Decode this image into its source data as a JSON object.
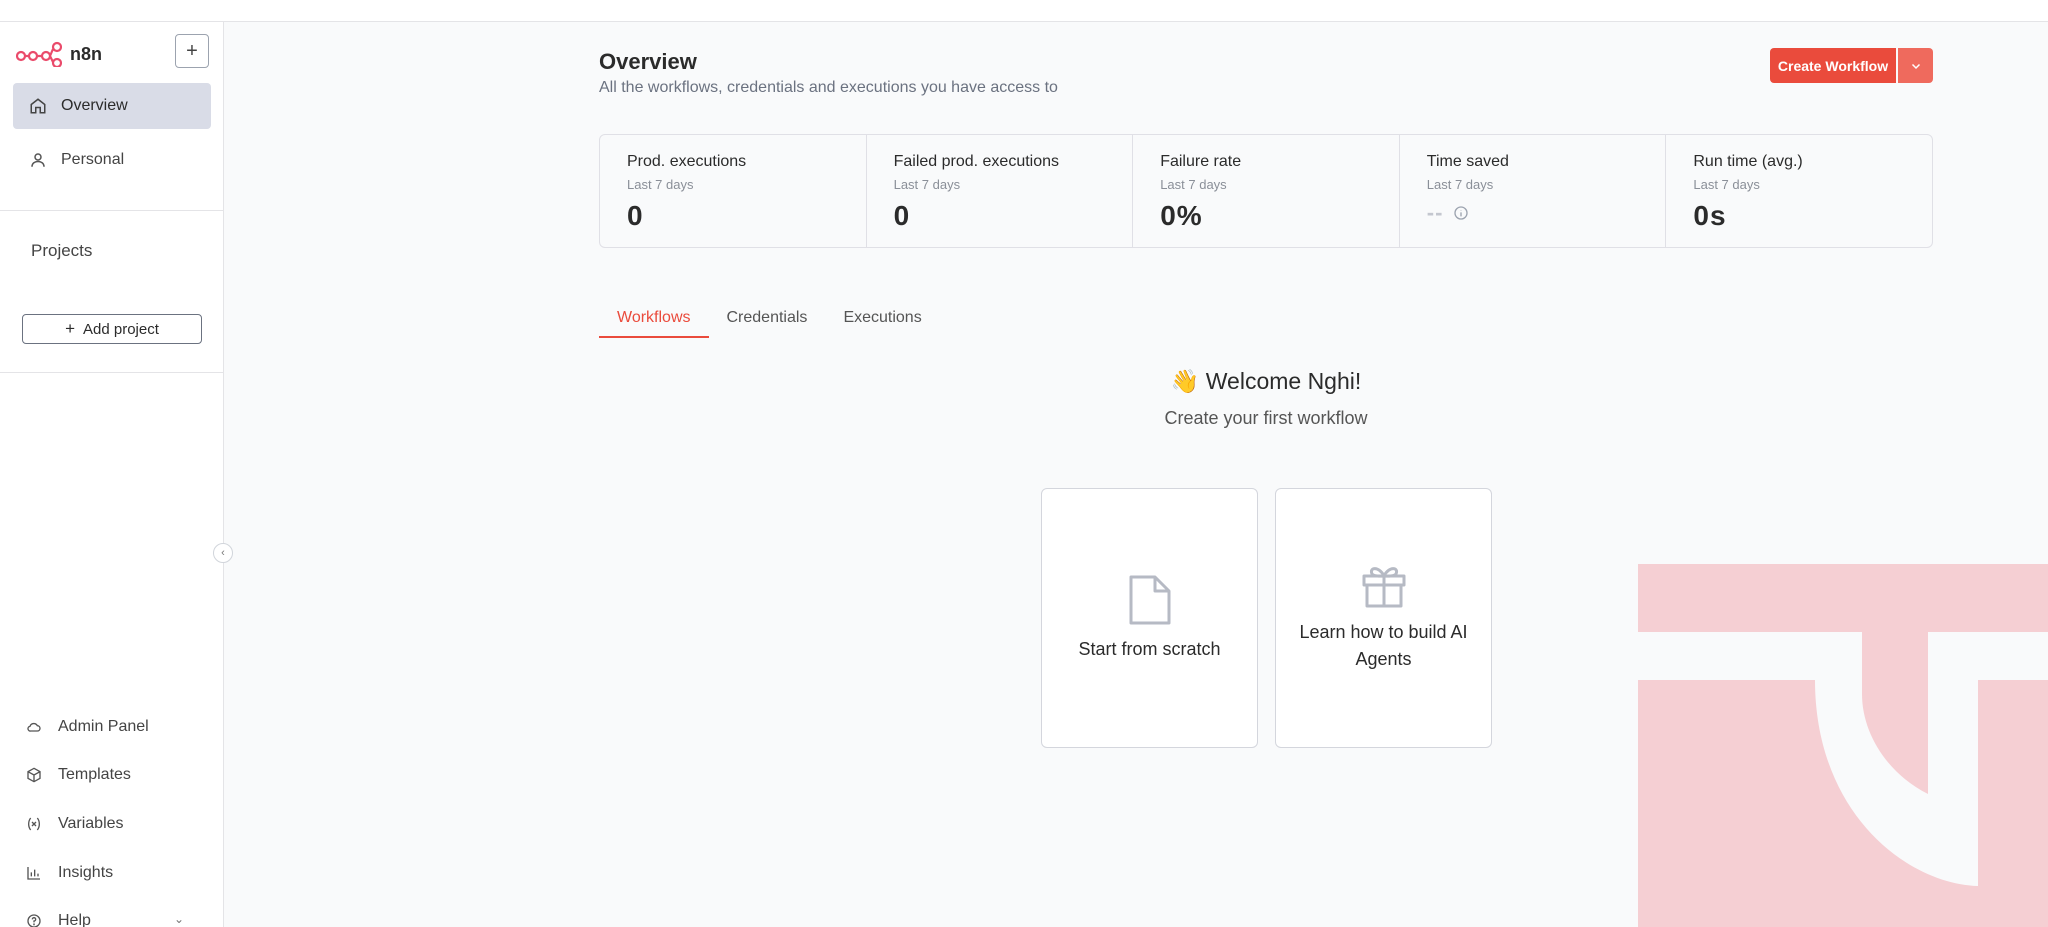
{
  "app": {
    "name": "n8n"
  },
  "sidebar": {
    "nav": [
      {
        "label": "Overview",
        "icon": "home-icon"
      },
      {
        "label": "Personal",
        "icon": "user-icon"
      }
    ],
    "projects_title": "Projects",
    "add_project": "Add project",
    "bottom": [
      {
        "label": "Admin Panel",
        "icon": "cloud-icon"
      },
      {
        "label": "Templates",
        "icon": "box-icon"
      },
      {
        "label": "Variables",
        "icon": "variable-icon"
      },
      {
        "label": "Insights",
        "icon": "chart-icon"
      },
      {
        "label": "Help",
        "icon": "help-icon"
      }
    ]
  },
  "header": {
    "title": "Overview",
    "subtitle": "All the workflows, credentials and executions you have access to",
    "create_button": "Create Workflow"
  },
  "stats": [
    {
      "label": "Prod. executions",
      "period": "Last 7 days",
      "value": "0"
    },
    {
      "label": "Failed prod. executions",
      "period": "Last 7 days",
      "value": "0"
    },
    {
      "label": "Failure rate",
      "period": "Last 7 days",
      "value": "0%"
    },
    {
      "label": "Time saved",
      "period": "Last 7 days",
      "value": "--"
    },
    {
      "label": "Run time (avg.)",
      "period": "Last 7 days",
      "value": "0s"
    }
  ],
  "tabs": [
    {
      "label": "Workflows",
      "active": true
    },
    {
      "label": "Credentials",
      "active": false
    },
    {
      "label": "Executions",
      "active": false
    }
  ],
  "welcome": {
    "emoji": "👋",
    "title": "Welcome Nghi!",
    "subtitle": "Create your first workflow"
  },
  "cards": [
    {
      "label": "Start from scratch",
      "icon": "file-icon"
    },
    {
      "label": "Learn how to build AI Agents",
      "icon": "gift-icon"
    }
  ],
  "colors": {
    "accent": "#ea4b3c",
    "active_nav_bg": "#d9dce7",
    "watermark": "#f5cfd3"
  }
}
